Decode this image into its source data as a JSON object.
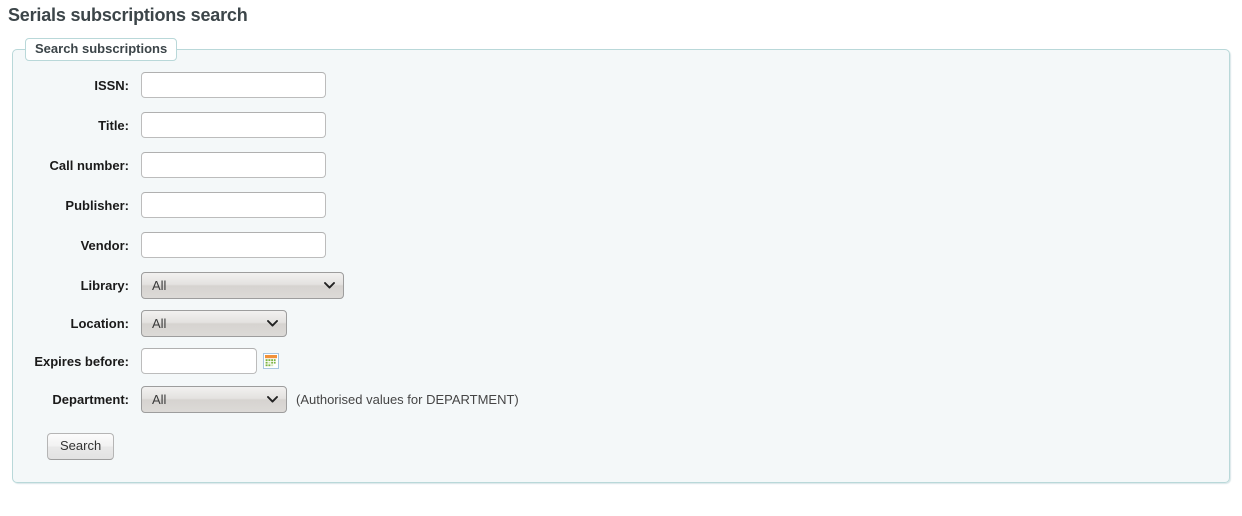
{
  "page": {
    "title": "Serials subscriptions search"
  },
  "search_panel": {
    "legend": "Search subscriptions",
    "fields": [
      {
        "label": "ISSN:",
        "name": "issn",
        "type": "text",
        "value": "",
        "placeholder": ""
      },
      {
        "label": "Title:",
        "name": "title",
        "type": "text",
        "value": "",
        "placeholder": ""
      },
      {
        "label": "Call number:",
        "name": "callnumber",
        "type": "text",
        "value": "",
        "placeholder": ""
      },
      {
        "label": "Publisher:",
        "name": "publisher",
        "type": "text",
        "value": "",
        "placeholder": ""
      },
      {
        "label": "Vendor:",
        "name": "vendor",
        "type": "text",
        "value": "",
        "placeholder": ""
      },
      {
        "label": "Library:",
        "name": "library",
        "type": "select",
        "value": "All",
        "options": [
          "All"
        ]
      },
      {
        "label": "Location:",
        "name": "location",
        "type": "select",
        "value": "All",
        "options": [
          "All"
        ]
      },
      {
        "label": "Expires before:",
        "name": "expires_before",
        "type": "date",
        "value": "",
        "placeholder": "",
        "icon": "calendar-icon"
      },
      {
        "label": "Department:",
        "name": "department",
        "type": "select",
        "value": "All",
        "options": [
          "All"
        ],
        "hint": "(Authorised values for DEPARTMENT)"
      }
    ],
    "submit_label": "Search"
  },
  "colors": {
    "panel_border": "#b9d8d9",
    "panel_background": "#f4f8f9",
    "title_text": "#3c4549",
    "calendar_header": "#f0913a",
    "calendar_days": "#7cb342"
  }
}
